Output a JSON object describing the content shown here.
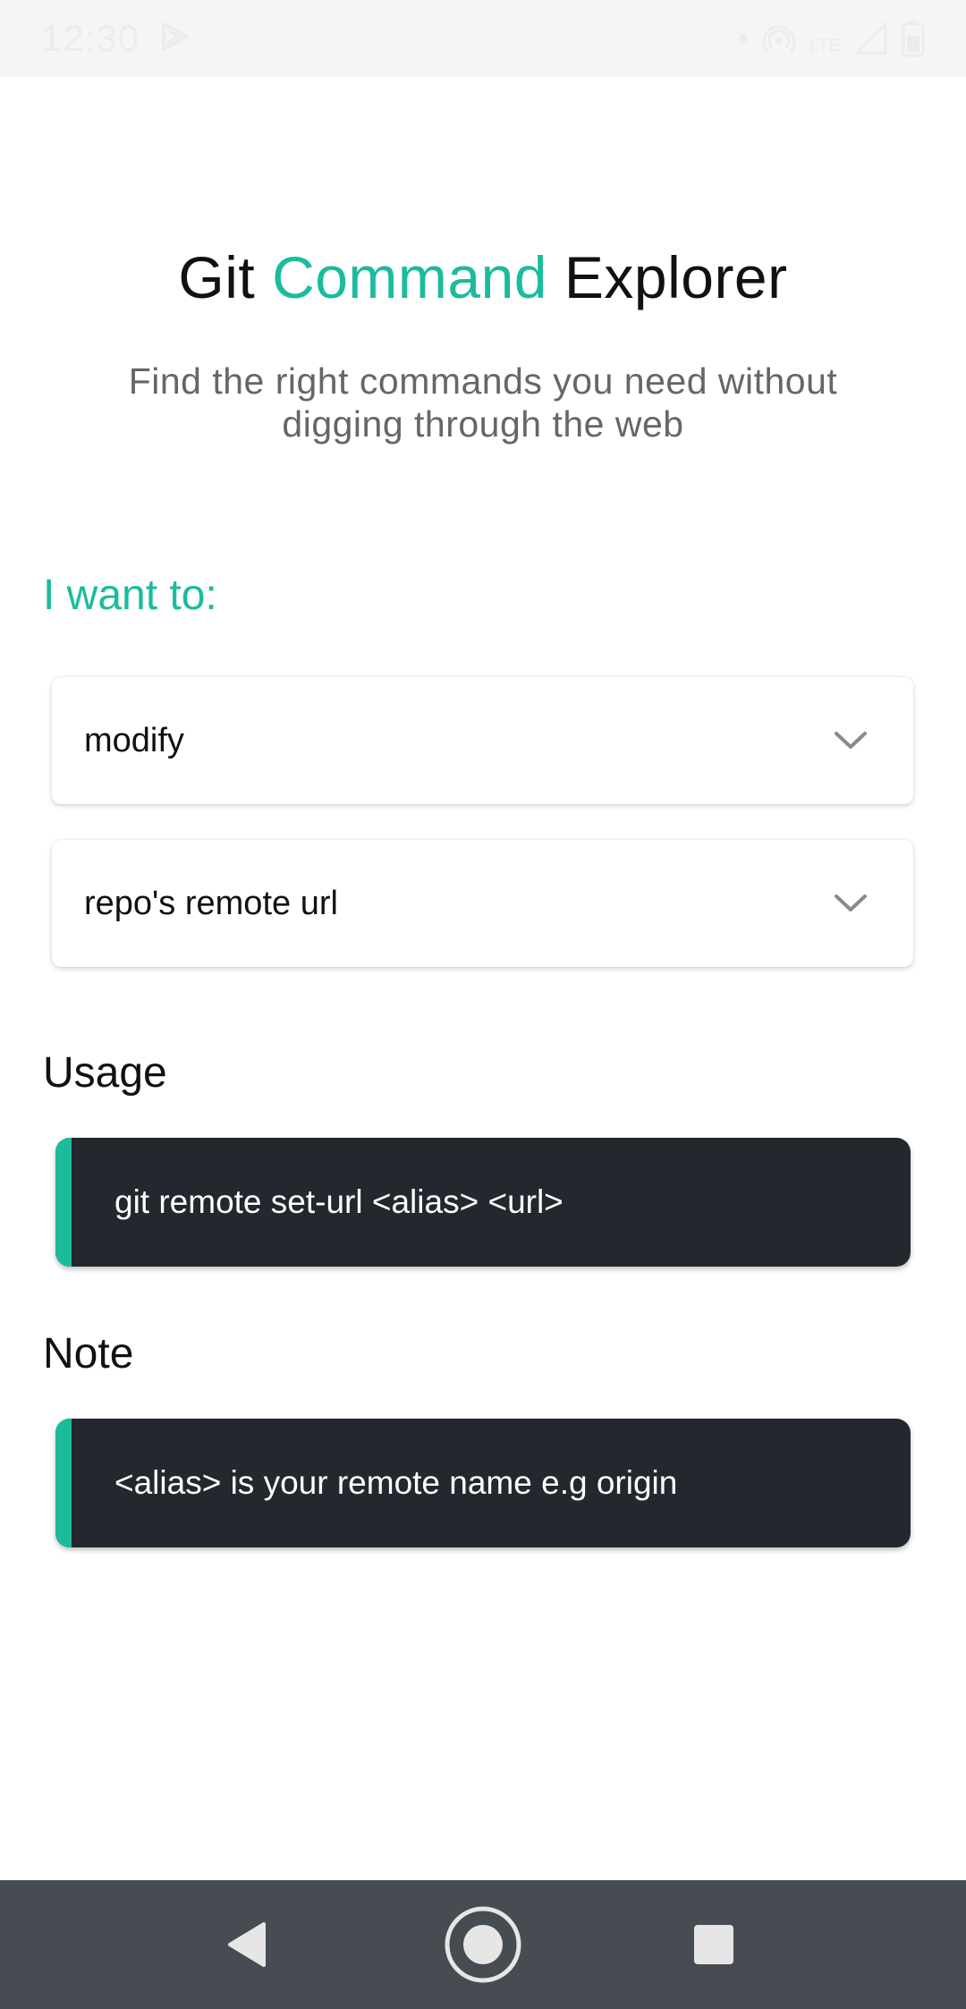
{
  "status_bar": {
    "time": "12:30",
    "network": "LTE"
  },
  "header": {
    "title_part1": "Git ",
    "title_accent": "Command",
    "title_part2": " Explorer",
    "subtitle": "Find the right commands you need without digging through the web"
  },
  "form": {
    "label": "I want to:",
    "primary_option": "modify",
    "secondary_option": "repo's remote url"
  },
  "usage": {
    "heading": "Usage",
    "command": "git remote set-url <alias> <url>"
  },
  "note": {
    "heading": "Note",
    "text": "<alias> is your remote name e.g origin"
  },
  "colors": {
    "accent": "#1abc9c",
    "code_bg": "#23272e",
    "nav_bg": "#464c52"
  },
  "icons": {
    "dropdown": "chevron-down-icon",
    "back": "back-triangle-icon",
    "home": "home-circle-icon",
    "recents": "recents-square-icon"
  }
}
